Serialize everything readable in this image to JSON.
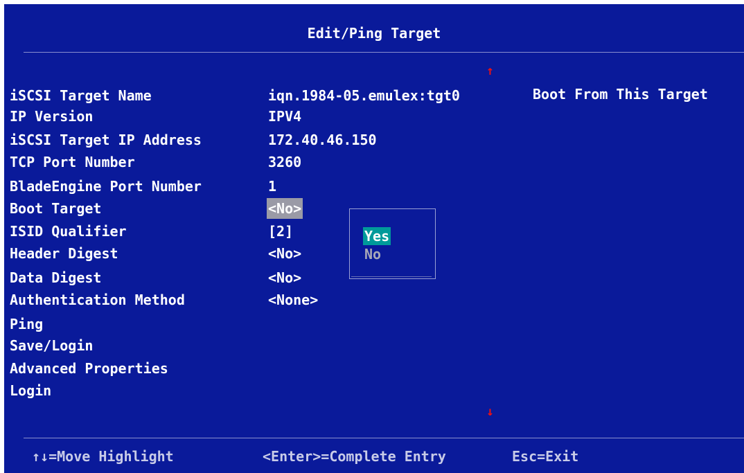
{
  "title": "Edit/Ping Target",
  "fields": [
    {
      "label": "iSCSI Target Name",
      "value": "iqn.1984-05.emulex:tgt0"
    },
    {
      "label": "IP Version",
      "value": "IPV4"
    },
    {
      "label": "iSCSI Target IP Address",
      "value": "172.40.46.150"
    },
    {
      "label": "TCP Port Number",
      "value": "3260"
    },
    {
      "label": "BladeEngine Port Number",
      "value": "1"
    },
    {
      "label": "Boot Target",
      "value": "<No>"
    },
    {
      "label": "ISID Qualifier",
      "value": "[2]"
    },
    {
      "label": "Header Digest",
      "value": "<No>"
    },
    {
      "label": "Data Digest",
      "value": "<No>"
    },
    {
      "label": "Authentication Method",
      "value": "<None>"
    },
    {
      "label": "Ping",
      "value": ""
    },
    {
      "label": "Save/Login",
      "value": ""
    },
    {
      "label": "Advanced Properties",
      "value": ""
    },
    {
      "label": "Login",
      "value": ""
    }
  ],
  "help_text": "Boot From This Target",
  "popup": {
    "options": [
      "Yes",
      "No"
    ],
    "highlighted": "Yes"
  },
  "scroll": {
    "up_arrow": "↑",
    "down_arrow": "↓"
  },
  "footer": {
    "move": "↑↓=Move Highlight",
    "enter": "<Enter>=Complete Entry",
    "esc": "Esc=Exit"
  },
  "colors": {
    "background": "#0a1a9a",
    "selection": "#009a9a",
    "scroll_arrow": "#ee1111"
  }
}
